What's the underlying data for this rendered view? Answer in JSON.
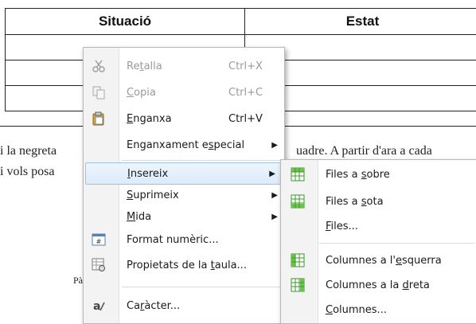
{
  "table": {
    "headers": [
      "Situació",
      "Estat"
    ]
  },
  "document": {
    "line1_left": "i la negreta",
    "line1_right": "uadre. A partir d'ara a cada",
    "line2_left": "i vols posa",
    "page_label": "Pàg"
  },
  "context_menu": {
    "items": [
      {
        "pre": "Re",
        "u": "t",
        "post": "alla",
        "shortcut": "Ctrl+X",
        "enabled": false,
        "icon": "scissors-icon"
      },
      {
        "pre": "",
        "u": "C",
        "post": "opia",
        "shortcut": "Ctrl+C",
        "enabled": false,
        "icon": "copy-icon"
      },
      {
        "pre": "",
        "u": "E",
        "post": "nganxa",
        "shortcut": "Ctrl+V",
        "enabled": true,
        "icon": "clipboard-icon"
      },
      {
        "pre": "Enganxament e",
        "u": "s",
        "post": "pecial",
        "submenu": true
      },
      {
        "pre": "",
        "u": "I",
        "post": "nsereix",
        "submenu": true,
        "highlighted": true
      },
      {
        "pre": "",
        "u": "S",
        "post": "uprimeix",
        "submenu": true
      },
      {
        "pre": "",
        "u": "M",
        "post": "ida",
        "submenu": true
      },
      {
        "pre": "Format numèric...",
        "u": "",
        "post": "",
        "icon": "number-format-icon"
      },
      {
        "pre": "Propietats de la ",
        "u": "t",
        "post": "aula...",
        "icon": "table-properties-icon"
      },
      {
        "pre": "Ca",
        "u": "r",
        "post": "àcter...",
        "icon": "character-icon"
      }
    ]
  },
  "insert_submenu": {
    "items": [
      {
        "pre": "Files a ",
        "u": "s",
        "post": "obre",
        "icon": "rows-above-icon"
      },
      {
        "pre": "Files a ",
        "u": "s",
        "post": "ota",
        "icon": "rows-below-icon"
      },
      {
        "pre": "",
        "u": "F",
        "post": "iles...",
        "icon": ""
      },
      {
        "pre": "Columnes a l'",
        "u": "e",
        "post": "squerra",
        "icon": "columns-left-icon"
      },
      {
        "pre": "Columnes a la ",
        "u": "d",
        "post": "reta",
        "icon": "columns-right-icon"
      },
      {
        "pre": "",
        "u": "C",
        "post": "olumnes...",
        "icon": ""
      }
    ]
  },
  "colors": {
    "icon_green": "#3a9a2a",
    "highlight": "#dbeafb"
  }
}
